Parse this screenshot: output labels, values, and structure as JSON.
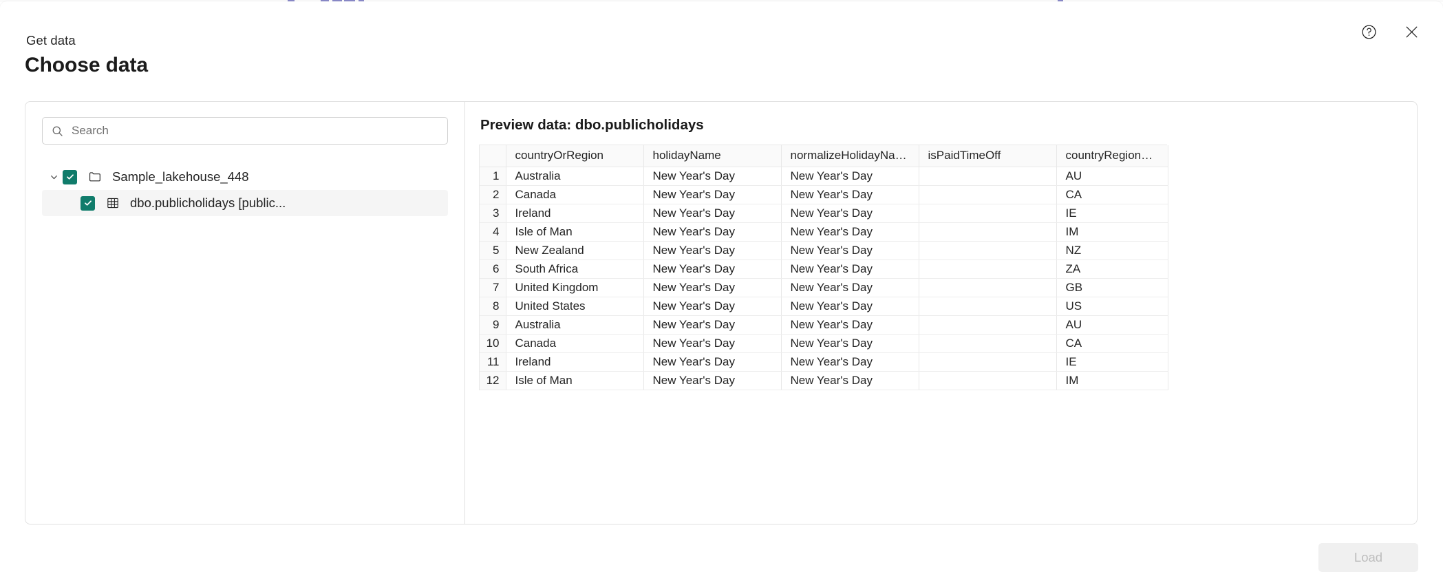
{
  "window": {
    "eyebrow": "Get data",
    "title": "Choose data"
  },
  "header": {
    "help_icon": "help-circle-icon",
    "close_icon": "close-icon"
  },
  "search": {
    "placeholder": "Search",
    "value": "",
    "icon": "search-icon"
  },
  "tree": {
    "items": [
      {
        "label": "Sample_lakehouse_448",
        "level": 0,
        "checked": true,
        "expanded": true,
        "selected": false,
        "icon": "folder-icon",
        "chevron": "chevron-down-icon"
      },
      {
        "label": "dbo.publicholidays [public...",
        "level": 1,
        "checked": true,
        "expanded": false,
        "selected": true,
        "icon": "table-icon",
        "chevron": ""
      }
    ]
  },
  "preview": {
    "title": "Preview data: dbo.publicholidays",
    "columns": [
      "",
      "countryOrRegion",
      "holidayName",
      "normalizeHolidayName",
      "isPaidTimeOff",
      "countryRegionCode"
    ],
    "rows": [
      [
        "1",
        "Australia",
        "New Year's Day",
        "New Year's Day",
        "",
        "AU"
      ],
      [
        "2",
        "Canada",
        "New Year's Day",
        "New Year's Day",
        "",
        "CA"
      ],
      [
        "3",
        "Ireland",
        "New Year's Day",
        "New Year's Day",
        "",
        "IE"
      ],
      [
        "4",
        "Isle of Man",
        "New Year's Day",
        "New Year's Day",
        "",
        "IM"
      ],
      [
        "5",
        "New Zealand",
        "New Year's Day",
        "New Year's Day",
        "",
        "NZ"
      ],
      [
        "6",
        "South Africa",
        "New Year's Day",
        "New Year's Day",
        "",
        "ZA"
      ],
      [
        "7",
        "United Kingdom",
        "New Year's Day",
        "New Year's Day",
        "",
        "GB"
      ],
      [
        "8",
        "United States",
        "New Year's Day",
        "New Year's Day",
        "",
        "US"
      ],
      [
        "9",
        "Australia",
        "New Year's Day",
        "New Year's Day",
        "",
        "AU"
      ],
      [
        "10",
        "Canada",
        "New Year's Day",
        "New Year's Day",
        "",
        "CA"
      ],
      [
        "11",
        "Ireland",
        "New Year's Day",
        "New Year's Day",
        "",
        "IE"
      ],
      [
        "12",
        "Isle of Man",
        "New Year's Day",
        "New Year's Day",
        "",
        "IM"
      ]
    ]
  },
  "footer": {
    "load_label": "Load",
    "load_disabled": true
  },
  "colors": {
    "checkbox_green": "#107c6b",
    "text_primary": "#242424",
    "border": "#e1e1e1",
    "selected_row": "#f5f5f5",
    "header_bg": "#fafafa",
    "disabled_button_bg": "#f0f0f0",
    "disabled_button_text": "#bdbdbd"
  }
}
